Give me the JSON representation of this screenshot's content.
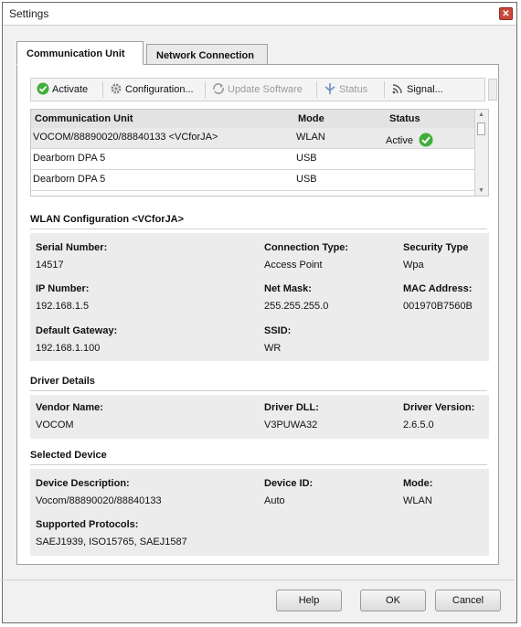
{
  "window": {
    "title": "Settings"
  },
  "tabs": [
    {
      "label": "Communication Unit"
    },
    {
      "label": "Network Connection"
    }
  ],
  "toolbar": {
    "activate": "Activate",
    "configuration": "Configuration...",
    "update_software": "Update Software",
    "status": "Status",
    "signal": "Signal..."
  },
  "units_table": {
    "headers": {
      "unit": "Communication Unit",
      "mode": "Mode",
      "status": "Status"
    },
    "rows": [
      {
        "unit": "VOCOM/88890020/88840133 <VCforJA>",
        "mode": "WLAN",
        "status": "Active"
      },
      {
        "unit": "Dearborn DPA 5",
        "mode": "USB",
        "status": ""
      },
      {
        "unit": "Dearborn DPA 5",
        "mode": "USB",
        "status": ""
      }
    ]
  },
  "wlan": {
    "heading": "WLAN Configuration <VCforJA>",
    "serial_label": "Serial Number:",
    "serial": "14517",
    "conn_type_label": "Connection Type:",
    "conn_type": "Access Point",
    "sec_type_label": "Security Type",
    "sec_type": "Wpa",
    "ip_label": "IP Number:",
    "ip": "192.168.1.5",
    "netmask_label": "Net Mask:",
    "netmask": "255.255.255.0",
    "mac_label": "MAC Address:",
    "mac": "001970B7560B",
    "gateway_label": "Default Gateway:",
    "gateway": "192.168.1.100",
    "ssid_label": "SSID:",
    "ssid": "WR"
  },
  "driver": {
    "heading": "Driver Details",
    "vendor_label": "Vendor Name:",
    "vendor": "VOCOM",
    "dll_label": "Driver DLL:",
    "dll": "V3PUWA32",
    "version_label": "Driver Version:",
    "version": "2.6.5.0"
  },
  "device": {
    "heading": "Selected Device",
    "desc_label": "Device Description:",
    "desc": "Vocom/88890020/88840133",
    "id_label": "Device ID:",
    "id": "Auto",
    "mode_label": "Mode:",
    "mode": "WLAN",
    "protocols_label": "Supported Protocols:",
    "protocols": "SAEJ1939, ISO15765, SAEJ1587"
  },
  "buttons": {
    "help": "Help",
    "ok": "OK",
    "cancel": "Cancel"
  },
  "colors": {
    "active_check": "#3fae3a",
    "close": "#c9483a"
  }
}
